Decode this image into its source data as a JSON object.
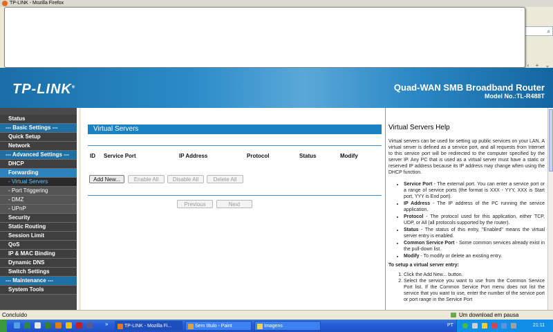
{
  "browser": {
    "window_title": "TP-LINK - Mozilla Firefox",
    "status_text": "Concluído",
    "download_status": "Um download em pausa"
  },
  "header": {
    "logo": "TP-LINK",
    "product_name": "Quad-WAN SMB Broadband Router",
    "model": "Model No.:TL-R488T"
  },
  "sidebar": {
    "items": [
      {
        "label": "Status",
        "type": "item"
      },
      {
        "label": "--- Basic Settings ---",
        "type": "group"
      },
      {
        "label": "Quick Setup",
        "type": "item"
      },
      {
        "label": "Network",
        "type": "item"
      },
      {
        "label": "--- Advanced Settings ---",
        "type": "group"
      },
      {
        "label": "DHCP",
        "type": "item"
      },
      {
        "label": "Forwarding",
        "type": "open"
      },
      {
        "label": "- Virtual Servers",
        "type": "sub-active"
      },
      {
        "label": "- Port Triggering",
        "type": "sub"
      },
      {
        "label": "- DMZ",
        "type": "sub"
      },
      {
        "label": "- UPnP",
        "type": "sub"
      },
      {
        "label": "Security",
        "type": "item"
      },
      {
        "label": "Static Routing",
        "type": "item"
      },
      {
        "label": "Session Limit",
        "type": "item"
      },
      {
        "label": "QoS",
        "type": "item"
      },
      {
        "label": "IP & MAC Binding",
        "type": "item"
      },
      {
        "label": "Dynamic DNS",
        "type": "item"
      },
      {
        "label": "Switch Settings",
        "type": "item"
      },
      {
        "label": "--- Maintenance ---",
        "type": "group"
      },
      {
        "label": "System Tools",
        "type": "item"
      }
    ]
  },
  "main": {
    "title": "Virtual Servers",
    "columns": [
      "ID",
      "Service Port",
      "IP Address",
      "Protocol",
      "Status",
      "Modify"
    ],
    "buttons": {
      "add_new": "Add New...",
      "enable_all": "Enable All",
      "disable_all": "Disable All",
      "delete_all": "Delete All",
      "previous": "Previous",
      "next": "Next"
    }
  },
  "help": {
    "title": "Virtual Servers Help",
    "intro": "Virtual servers can be used for setting up public services on your LAN. A virtual server is defined as a service port, and all requests from Internet to this service port will be redirected to the computer specified by the server IP. Any PC that is used as a virtual server must have a static or reserved IP address because its IP address may change when using the DHCP function.",
    "fields": [
      {
        "name": "Service Port",
        "desc": " - The external port. You can enter a service port or a range of service ports (the format is XXX - YYY, XXX is Start port, YYY is End port)."
      },
      {
        "name": "IP Address",
        "desc": " - The IP address of the PC running the service application."
      },
      {
        "name": "Protocol",
        "desc": " - The protocol used for this application, either TCP, UDP, or All (all protocols supported by the router)."
      },
      {
        "name": "Status",
        "desc": " - The status of this entry, \"Enabled\" means the virtual server entry is enabled."
      },
      {
        "name": "Common Service Port",
        "desc": " - Some common services already exist in the pull-down list."
      },
      {
        "name": "Modify",
        "desc": " - To modify or delete an existing entry."
      }
    ],
    "setup_title": "To setup a virtual server entry:",
    "steps": [
      "Click the Add New... button.",
      "Select the service you want to use from the Common Service Port list. If the Common Service Port menu does not list the service that you want to use, enter the number of the service port or port range in the Service Port"
    ]
  },
  "taskbar": {
    "tasks": [
      "TP-LINK - Mozilla Fi...",
      "Sem título - Paint",
      "Imagens"
    ],
    "language": "PT",
    "clock": "21:11"
  },
  "colors": {
    "header_blue": "#2b8cc8",
    "sidebar_bg": "#4a4a4a",
    "group_blue": "#1e6fa3",
    "title_bar_blue": "#1a81c2",
    "active_sub": "#5fc3ff"
  }
}
